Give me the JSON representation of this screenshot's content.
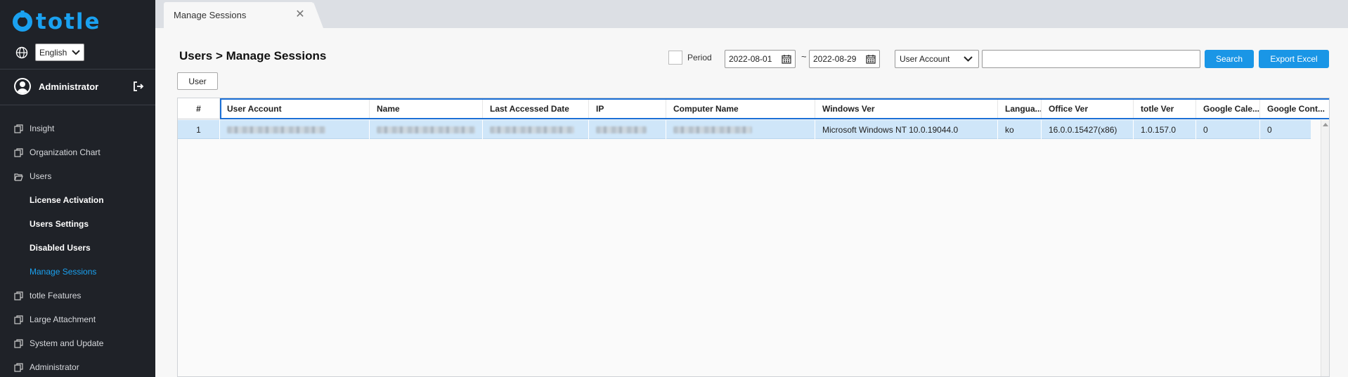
{
  "app": {
    "logo_text": "totle",
    "language": "English"
  },
  "user": {
    "name": "Administrator"
  },
  "sidebar": {
    "items": [
      {
        "label": "Insight",
        "type": "top"
      },
      {
        "label": "Organization Chart",
        "type": "top"
      },
      {
        "label": "Users",
        "type": "top"
      },
      {
        "label": "License Activation",
        "type": "sub"
      },
      {
        "label": "Users Settings",
        "type": "sub"
      },
      {
        "label": "Disabled Users",
        "type": "sub"
      },
      {
        "label": "Manage Sessions",
        "type": "sub",
        "active": true
      },
      {
        "label": "totle Features",
        "type": "top"
      },
      {
        "label": "Large Attachment",
        "type": "top"
      },
      {
        "label": "System and Update",
        "type": "top"
      },
      {
        "label": "Administrator",
        "type": "top"
      }
    ]
  },
  "tabs": [
    {
      "label": "Manage Sessions"
    }
  ],
  "page": {
    "title": "Users > Manage Sessions",
    "period_label": "Period",
    "date_from": "2022-08-01",
    "date_sep": "~",
    "date_to": "2022-08-29",
    "search_field": "User Account",
    "search_value": "",
    "search_button": "Search",
    "export_button": "Export Excel",
    "user_button": "User"
  },
  "table": {
    "columns": [
      "#",
      "User Account",
      "Name",
      "Last Accessed Date",
      "IP",
      "Computer Name",
      "Windows Ver",
      "Langua...",
      "Office Ver",
      "totle Ver",
      "Google Cale...",
      "Google Cont..."
    ],
    "rows": [
      {
        "index": "1",
        "windows_ver": "Microsoft Windows NT 10.0.19044.0",
        "language": "ko",
        "office_ver": "16.0.0.15427(x86)",
        "totle_ver": "1.0.157.0",
        "google_calendar": "0",
        "google_contacts": "0"
      }
    ]
  },
  "colors": {
    "accent": "#1a96e6",
    "sidebar_bg": "#1f2228",
    "selected_row": "#cfe6f9",
    "header_focus": "#1a6fd6"
  }
}
